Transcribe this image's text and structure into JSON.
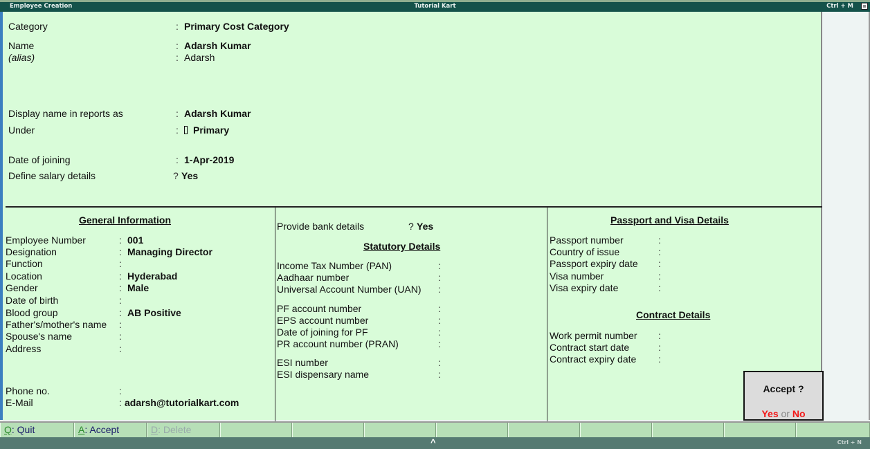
{
  "window": {
    "left_title": "Employee Creation",
    "center_title": "Tutorial Kart",
    "shortcut": "Ctrl + M"
  },
  "header": {
    "category": {
      "label": "Category",
      "sep": ":",
      "value": "Primary Cost Category"
    },
    "name": {
      "label": "Name",
      "sep": ":",
      "value": "Adarsh Kumar"
    },
    "alias": {
      "label": "(alias)",
      "sep": ":",
      "value": "Adarsh"
    },
    "display_name": {
      "label": "Display name in reports as",
      "sep": ":",
      "value": "Adarsh Kumar"
    },
    "under": {
      "label": "Under",
      "sep": ":",
      "value": "Primary",
      "icon": "group-marker-icon"
    },
    "date_of_joining": {
      "label": "Date of joining",
      "sep": ":",
      "value": "1-Apr-2019"
    },
    "define_salary": {
      "label": "Define salary details",
      "sep": "?",
      "value": "Yes"
    }
  },
  "general": {
    "title": "General Information",
    "fields": [
      {
        "label": "Employee Number",
        "value": "001"
      },
      {
        "label": "Designation",
        "value": "Managing Director"
      },
      {
        "label": "Function",
        "value": ""
      },
      {
        "label": "Location",
        "value": "Hyderabad"
      },
      {
        "label": "Gender",
        "value": "Male"
      },
      {
        "label": "Date of birth",
        "value": ""
      },
      {
        "label": "Blood group",
        "value": "AB Positive"
      },
      {
        "label": "Father's/mother's name",
        "value": ""
      },
      {
        "label": "Spouse's name",
        "value": ""
      },
      {
        "label": "Address",
        "value": ""
      }
    ],
    "phone": {
      "label": "Phone no.",
      "value": ""
    },
    "email": {
      "label": "E-Mail",
      "value": "adarsh@tutorialkart.com"
    }
  },
  "bank": {
    "label": "Provide bank details",
    "sep": "?",
    "value": "Yes"
  },
  "statutory": {
    "title": "Statutory Details",
    "fields": [
      {
        "label": "Income Tax Number (PAN)",
        "value": ""
      },
      {
        "label": "Aadhaar number",
        "value": ""
      },
      {
        "label": "Universal Account Number (UAN)",
        "value": ""
      },
      {
        "label": "PF account number",
        "value": ""
      },
      {
        "label": "EPS account number",
        "value": ""
      },
      {
        "label": "Date of joining for PF",
        "value": ""
      },
      {
        "label": "PR account number (PRAN)",
        "value": ""
      },
      {
        "label": "ESI number",
        "value": ""
      },
      {
        "label": "ESI dispensary name",
        "value": ""
      }
    ]
  },
  "passport": {
    "title": "Passport and Visa Details",
    "fields": [
      {
        "label": "Passport number",
        "value": ""
      },
      {
        "label": "Country of issue",
        "value": ""
      },
      {
        "label": "Passport expiry date",
        "value": ""
      },
      {
        "label": "Visa number",
        "value": ""
      },
      {
        "label": "Visa expiry date",
        "value": ""
      }
    ]
  },
  "contract": {
    "title": "Contract Details",
    "fields": [
      {
        "label": "Work permit number",
        "value": ""
      },
      {
        "label": "Contract start date",
        "value": ""
      },
      {
        "label": "Contract expiry date",
        "value": ""
      }
    ]
  },
  "accept_dialog": {
    "question": "Accept ?",
    "yes": "Yes",
    "or": "or",
    "no": "No"
  },
  "buttons": [
    {
      "key": "Q",
      "label": ": Quit",
      "enabled": true
    },
    {
      "key": "A",
      "label": ": Accept",
      "enabled": true
    },
    {
      "key": "D",
      "label": ": Delete",
      "enabled": false
    }
  ],
  "statusbar": {
    "caret": "^",
    "shortcut": "Ctrl + N"
  },
  "colors": {
    "title_bar": "#14524a",
    "form_bg": "#d9fcd9",
    "button_bar": "#b7dfb7",
    "accent_red": "#f21818"
  }
}
